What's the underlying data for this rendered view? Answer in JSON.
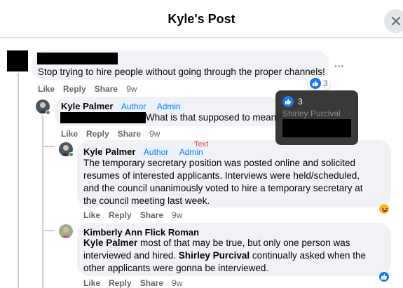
{
  "header": {
    "title": "Kyle's Post"
  },
  "comments": [
    {
      "text": "Stop trying to hire people without going through the proper channels!",
      "actions": {
        "like": "Like",
        "reply": "Reply",
        "share": "Share",
        "time": "9w"
      },
      "reaction_count": "3"
    },
    {
      "name": "Kyle Palmer",
      "badges": [
        "Author",
        "Admin"
      ],
      "text": "What is that supposed to mean?",
      "actions": {
        "like": "Like",
        "reply": "Reply",
        "share": "Share",
        "time": "9w"
      }
    },
    {
      "name": "Kyle Palmer",
      "badges": [
        "Author",
        "Admin"
      ],
      "annotation": "Text",
      "text": "The temporary secretary position was posted online and solicited resumes of interested applicants. Interviews were held/scheduled, and the council unanimously voted to hire a temporary secretary at the council meeting last week.",
      "actions": {
        "like": "Like",
        "reply": "Reply",
        "share": "Share",
        "time": "9w"
      },
      "reaction": "haha"
    },
    {
      "name": "Kimberly Ann Flick Roman",
      "mention1": "Kyle Palmer",
      "text1": " most of that may be true, but only one person was interviewed and hired. ",
      "mention2": "Shirley Purcival",
      "text2": " continually asked when the other applicants were gonna be interviewed.",
      "actions": {
        "like": "Like",
        "reply": "Reply",
        "share": "Share",
        "time": "9w"
      },
      "reaction": "like"
    }
  ],
  "tooltip": {
    "count": "3",
    "person": "Shirley Purcival"
  },
  "more_options": "···",
  "colors": {
    "accent": "#1877f2",
    "bubble": "#f0f2f5",
    "meta": "#65676b"
  }
}
